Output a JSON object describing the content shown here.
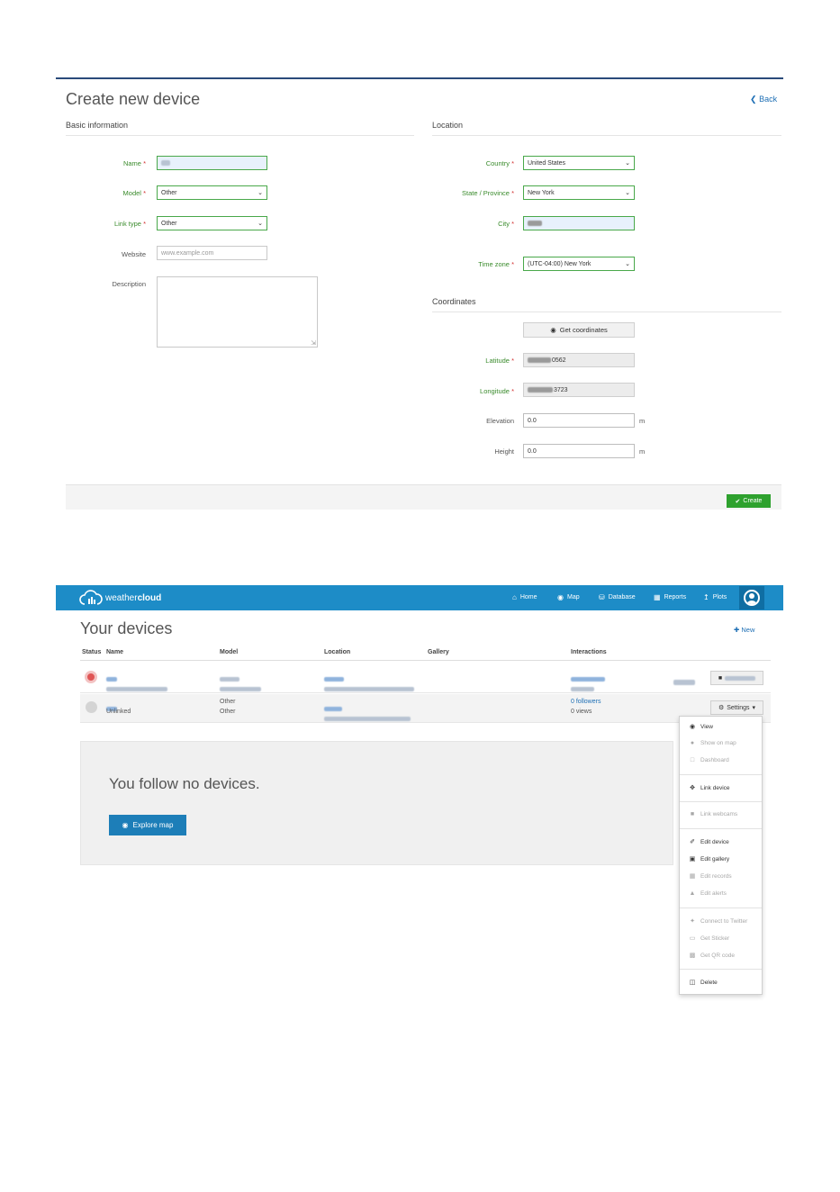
{
  "create": {
    "title": "Create new device",
    "back_label": "Back",
    "basic_section": "Basic information",
    "location_section": "Location",
    "coordinates_section": "Coordinates",
    "required_marker": "*",
    "fields": {
      "name_label": "Name",
      "model_label": "Model",
      "model_value": "Other",
      "link_type_label": "Link type",
      "link_type_value": "Other",
      "website_label": "Website",
      "website_placeholder": "www.example.com",
      "description_label": "Description",
      "country_label": "Country",
      "country_value": "United States",
      "state_label": "State / Province",
      "state_value": "New York",
      "city_label": "City",
      "timezone_label": "Time zone",
      "timezone_value": "(UTC-04:00) New York",
      "get_coordinates_label": "Get coordinates",
      "latitude_label": "Latitude",
      "latitude_value_visible": "0562",
      "longitude_label": "Longitude",
      "longitude_value_visible": "3723",
      "elevation_label": "Elevation",
      "elevation_value": "0.0",
      "height_label": "Height",
      "height_value": "0.0",
      "unit_m": "m"
    },
    "create_button": "Create"
  },
  "nav": {
    "brand_light": "weather",
    "brand_bold": "cloud",
    "items": [
      "Home",
      "Map",
      "Database",
      "Reports",
      "Plots"
    ]
  },
  "devices": {
    "title": "Your devices",
    "new_label": "New",
    "headers": {
      "status": "Status",
      "name": "Name",
      "model": "Model",
      "location": "Location",
      "gallery": "Gallery",
      "interactions": "Interactions"
    },
    "row2": {
      "status_text": "Unlinked",
      "model_1": "Other",
      "model_2": "Other",
      "followers": "0 followers",
      "views": "0 views",
      "settings_label": "Settings"
    },
    "follow_text": "You follow no devices.",
    "explore_label": "Explore map",
    "menu": {
      "view": "View",
      "show_on_map": "Show on map",
      "dashboard": "Dashboard",
      "link_device": "Link device",
      "link_webcams": "Link webcams",
      "edit_device": "Edit device",
      "edit_gallery": "Edit gallery",
      "edit_records": "Edit records",
      "edit_alerts": "Edit alerts",
      "connect_twitter": "Connect to Twitter",
      "get_sticker": "Get Sticker",
      "get_qr": "Get QR code",
      "delete": "Delete"
    }
  },
  "colors": {
    "navbar": "#1d8cc7",
    "field_border": "#49a84a",
    "create_button": "#2ea12e",
    "link": "#1e6fb5"
  }
}
